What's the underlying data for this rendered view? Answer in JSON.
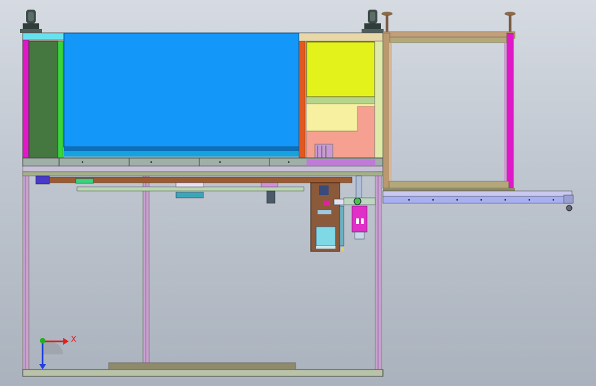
{
  "viewport": {
    "background_top": "#d6dbe2",
    "background_bottom": "#aab2bd"
  },
  "colors": {
    "panel_blue": "#1398fa",
    "panel_yellow": "#e4f21c",
    "panel_green_dark": "#457740",
    "accent_magenta": "#e018c8",
    "accent_orange": "#e2581e",
    "frame_lavender": "#b8a3c7",
    "cabinet_salmon": "#f5a090",
    "cabinet_cream": "#f6f0a0",
    "caster_dark": "#3c4a48"
  },
  "icons": {
    "triad": "coordinate-triad-icon",
    "caster": "caster-wheel-icon",
    "leveling_foot": "leveling-foot-icon"
  },
  "triad": {
    "x_label": "X",
    "x_color": "#e02020",
    "y_color": "#20b020",
    "z_color": "#2040e0"
  }
}
